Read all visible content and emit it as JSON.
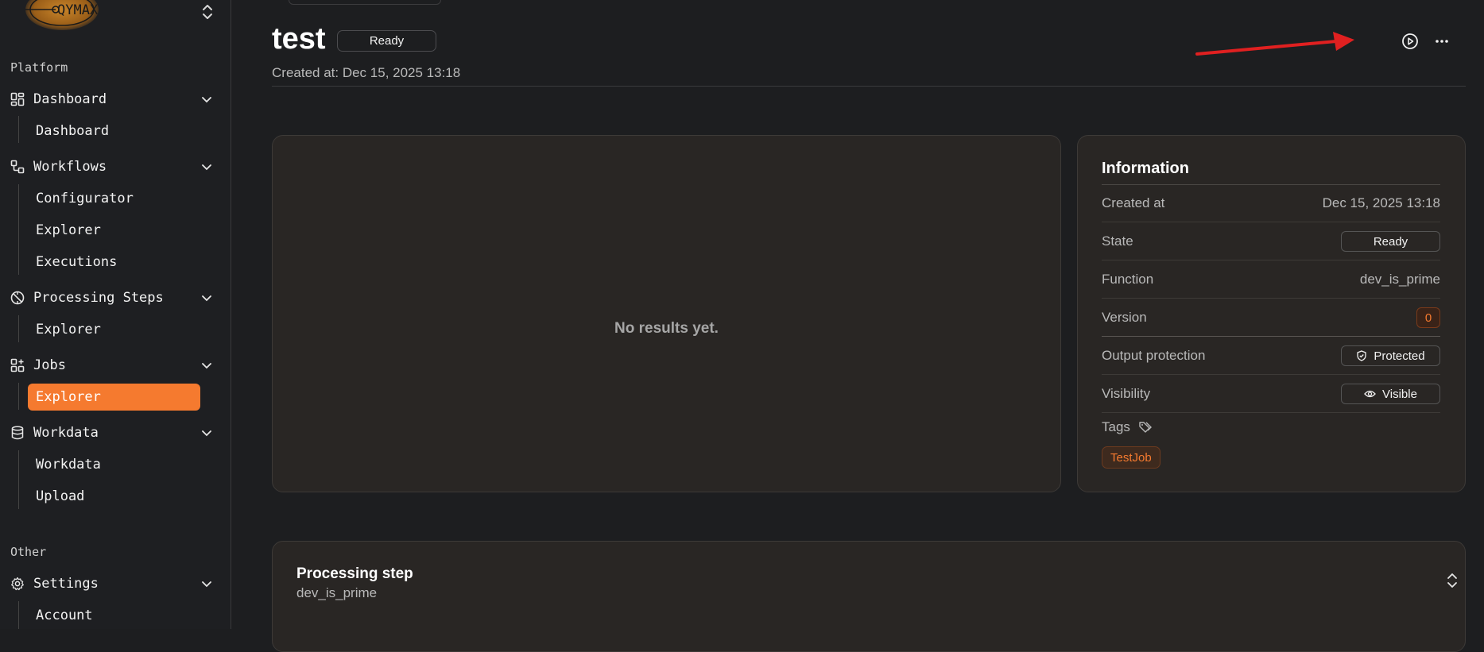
{
  "sidebar": {
    "logo_text": "QYMAX",
    "section_platform": "Platform",
    "section_other": "Other",
    "groups": [
      {
        "label": "Dashboard",
        "icon": "dashboard-grid-icon",
        "items": [
          "Dashboard"
        ]
      },
      {
        "label": "Workflows",
        "icon": "workflow-icon",
        "items": [
          "Configurator",
          "Explorer",
          "Executions"
        ]
      },
      {
        "label": "Processing Steps",
        "icon": "processing-steps-icon",
        "items": [
          "Explorer"
        ]
      },
      {
        "label": "Jobs",
        "icon": "jobs-icon",
        "items": [
          "Explorer"
        ]
      },
      {
        "label": "Workdata",
        "icon": "database-icon",
        "items": [
          "Workdata",
          "Upload"
        ]
      },
      {
        "label": "Settings",
        "icon": "gear-icon",
        "items": [
          "Account"
        ]
      }
    ],
    "active_item": "Jobs/Explorer"
  },
  "header": {
    "title": "test",
    "status": "Ready",
    "created_label": "Created at: Dec 15, 2025 13:18",
    "actions": [
      "play-circle-icon",
      "more-horizontal-icon"
    ]
  },
  "results": {
    "empty_text": "No results yet."
  },
  "info": {
    "title": "Information",
    "rows": [
      {
        "key": "Created at",
        "value": "Dec 15, 2025 13:18"
      },
      {
        "key": "State",
        "value": "Ready"
      },
      {
        "key": "Function",
        "value": "dev_is_prime"
      },
      {
        "key": "Version",
        "value": "0"
      },
      {
        "key": "Output protection",
        "value": "Protected"
      },
      {
        "key": "Visibility",
        "value": "Visible"
      }
    ],
    "tags_label": "Tags",
    "tags": [
      "TestJob"
    ]
  },
  "processing_step": {
    "title": "Processing step",
    "subtitle": "dev_is_prime"
  },
  "colors": {
    "accent": "#f57a2f",
    "annotation_arrow": "#e02020"
  }
}
